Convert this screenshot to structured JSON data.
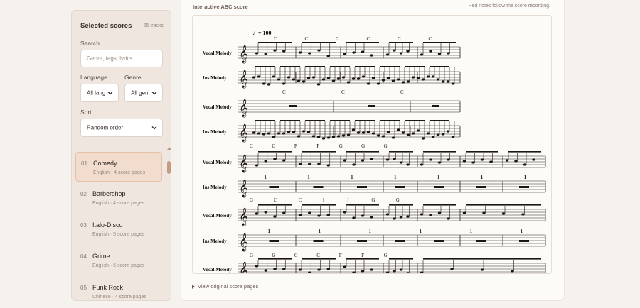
{
  "sidebar": {
    "title": "Selected scores",
    "count": "65 tracks",
    "search_label": "Search",
    "search_placeholder": "Genre, tags, lyrics",
    "language_label": "Language",
    "language_value": "All languages",
    "genre_label": "Genre",
    "genre_value": "All genres",
    "sort_label": "Sort",
    "sort_value": "Random order",
    "tracks": [
      {
        "num": "01",
        "name": "Comedy",
        "meta": "English · 4 score pages",
        "active": true
      },
      {
        "num": "02",
        "name": "Barbershop",
        "meta": "English · 4 score pages",
        "active": false
      },
      {
        "num": "03",
        "name": "Italo-Disco",
        "meta": "English · 5 score pages",
        "active": false
      },
      {
        "num": "04",
        "name": "Grime",
        "meta": "English · 6 score pages",
        "active": false
      },
      {
        "num": "05",
        "name": "Funk Rock",
        "meta": "Chinese · 4 score pages",
        "active": false
      }
    ]
  },
  "main": {
    "title": "Interactive ABC score",
    "note": "Red notes follow the score recording.",
    "toggle_label": "View original score pages"
  },
  "score": {
    "tempo": "= 100",
    "voice1": "Vocal Melody",
    "voice2": "Ins Melody",
    "systems": [
      {
        "chords": [
          "C",
          "C",
          "C",
          "C",
          "C",
          "C"
        ],
        "counts": []
      },
      {
        "chords": [
          "C",
          "C",
          "C"
        ],
        "counts": []
      },
      {
        "chords": [
          "C",
          "C",
          "F",
          "F",
          "G",
          "G",
          "G"
        ],
        "counts": [
          "1",
          "1",
          "1",
          "1",
          "1",
          "1",
          "1"
        ]
      },
      {
        "chords": [
          "G",
          "C",
          "C",
          "I",
          "I",
          "G",
          "G"
        ],
        "counts": [
          "1",
          "1",
          "1",
          "1",
          "1",
          "1"
        ]
      },
      {
        "chords": [
          "G",
          "G",
          "C",
          "C",
          "F",
          "F",
          "G"
        ],
        "counts": []
      }
    ],
    "colors": {
      "ink": "#1c1512",
      "staff": "#2a211d",
      "accent": "#e7c1a7"
    }
  }
}
